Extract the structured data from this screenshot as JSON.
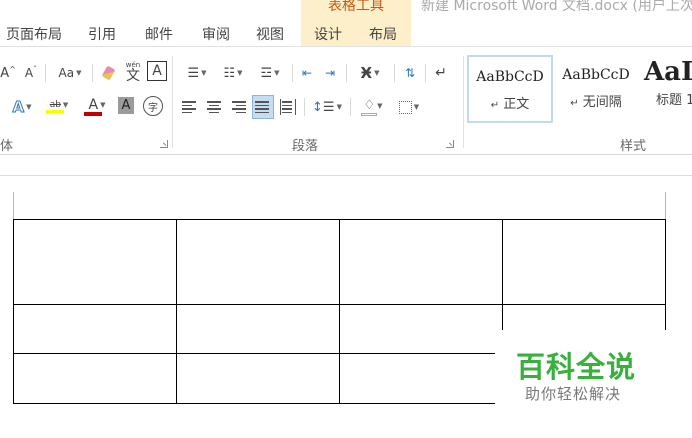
{
  "title_bar": {
    "context_title": "表格工具",
    "document_title": "新建 Microsoft Word 文档.docx (用户上次"
  },
  "tabs": [
    "页面布局",
    "引用",
    "邮件",
    "审阅",
    "视图",
    "设计",
    "布局"
  ],
  "ribbon": {
    "font_group": {
      "label": "体",
      "aa_label": "Aa",
      "phonetic_label": "wén",
      "phonetic_char": "文",
      "border_char": "A",
      "highlight_label": "ab",
      "font_color_label": "A",
      "shading_char": "A",
      "enclose_char": "字",
      "colors": {
        "highlight": "#ffff00",
        "font_color": "#c00000"
      }
    },
    "paragraph_group": {
      "label": "段落"
    },
    "styles_group": {
      "label": "样式",
      "styles": [
        {
          "sample": "AaBbCcD",
          "name": "正文",
          "marker": "↵",
          "selected": true
        },
        {
          "sample": "AaBbCcD",
          "name": "无间隔",
          "marker": "↵",
          "selected": false
        },
        {
          "sample": "AaI",
          "name": "标题 1",
          "marker": "",
          "selected": false
        }
      ]
    }
  },
  "table": {
    "rows": 3,
    "columns": 4
  },
  "watermark": {
    "title": "百科全说",
    "subtitle": "助你轻松解决",
    "color": "#38b03c"
  }
}
